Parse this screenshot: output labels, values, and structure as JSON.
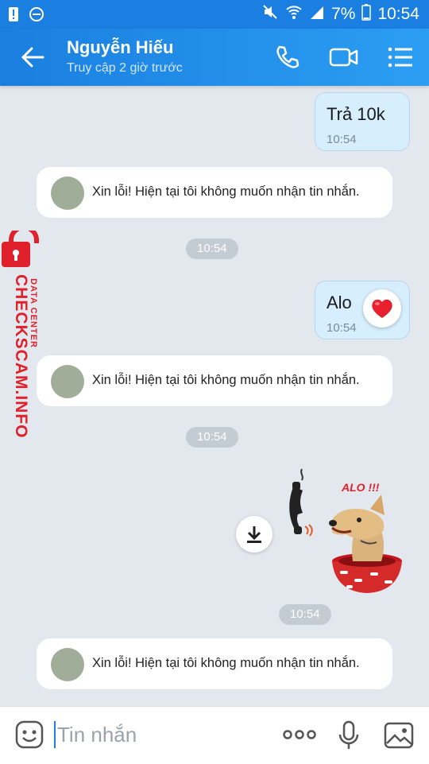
{
  "status_bar": {
    "battery": "7%",
    "time": "10:54",
    "icons": [
      "alert-icon",
      "minus-circle-icon",
      "mute-icon",
      "wifi-icon",
      "signal-icon",
      "battery-icon"
    ]
  },
  "header": {
    "title": "Nguyễn Hiếu",
    "subtitle": "Truy cập 2 giờ trước",
    "icons": [
      "back-arrow-icon",
      "phone-icon",
      "video-call-icon",
      "menu-icon"
    ]
  },
  "watermark": {
    "line1": "DATA CENTER",
    "line2": "CHECKSCAM.INFO"
  },
  "messages": [
    {
      "type": "outgoing",
      "text": "Trả 10k",
      "time": "10:54"
    },
    {
      "type": "system",
      "text": "Xin lỗi! Hiện tại tôi không muốn nhận tin nhắn."
    },
    {
      "type": "time",
      "text": "10:54"
    },
    {
      "type": "outgoing",
      "text": "Alo",
      "time": "10:54",
      "reaction": "heart"
    },
    {
      "type": "system",
      "text": "Xin lỗi! Hiện tại tôi không muốn nhận tin nhắn."
    },
    {
      "type": "time",
      "text": "10:54"
    },
    {
      "type": "sticker",
      "caption": "ALO !!!"
    },
    {
      "type": "time",
      "text": "10:54"
    },
    {
      "type": "system",
      "text": "Xin lỗi! Hiện tại tôi không muốn nhận tin nhắn."
    }
  ],
  "composer": {
    "placeholder": "Tin nhắn",
    "icons": [
      "emoji-icon",
      "more-icon",
      "microphone-icon",
      "image-icon"
    ]
  },
  "colors": {
    "header": "#1a7fe0",
    "outgoing_bubble": "#d6eefd",
    "chat_bg": "#e2e8ee",
    "heart": "#e8202e",
    "watermark": "#e0202a"
  }
}
